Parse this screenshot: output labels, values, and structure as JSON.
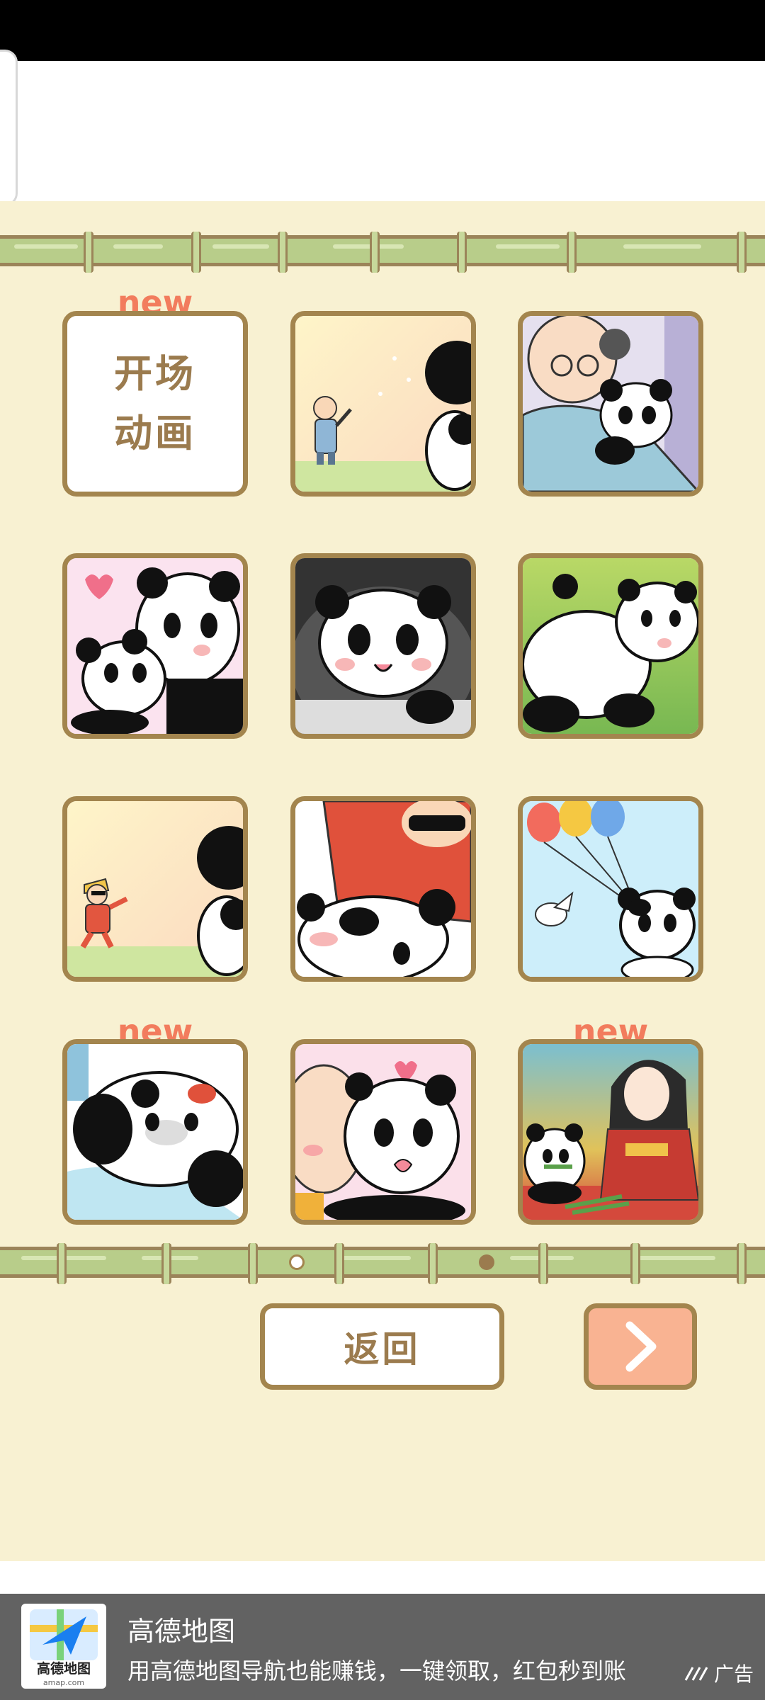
{
  "gallery": {
    "opening_label_line1": "开场",
    "opening_label_line2": "动画",
    "new_badge": "new",
    "tiles": [
      {
        "scene": "opening-animation",
        "new": true
      },
      {
        "scene": "old-man-waving",
        "new": false
      },
      {
        "scene": "old-man-hugging-panda",
        "new": false
      },
      {
        "scene": "panda-mother-and-baby",
        "new": false
      },
      {
        "scene": "panda-smiling-in-pot",
        "new": false
      },
      {
        "scene": "panda-lying-on-grass",
        "new": false
      },
      {
        "scene": "man-with-sunglasses-running",
        "new": false
      },
      {
        "scene": "panda-with-man-in-red",
        "new": false
      },
      {
        "scene": "panda-with-balloons",
        "new": true
      },
      {
        "scene": "panda-lying-blue-blanket",
        "new": true
      },
      {
        "scene": "panda-kissed-by-baby",
        "new": false
      },
      {
        "scene": "panda-with-kimono-girl",
        "new": false
      }
    ],
    "page_indicator": {
      "current": 1,
      "total": 2
    }
  },
  "buttons": {
    "back_label": "返回",
    "next_icon": "chevron-right-icon"
  },
  "ad": {
    "app_name": "高德地图",
    "description": "用高德地图导航也能赚钱，一键领取，红包秒到账",
    "logo_caption": "高德地图",
    "logo_subcaption": "amap.com",
    "ad_label": "广告"
  },
  "colors": {
    "background": "#f8f1d2",
    "frame": "#a3854e",
    "new_badge": "#f27c5d",
    "next_button": "#f9b392",
    "bamboo": "#b8cd8a"
  }
}
